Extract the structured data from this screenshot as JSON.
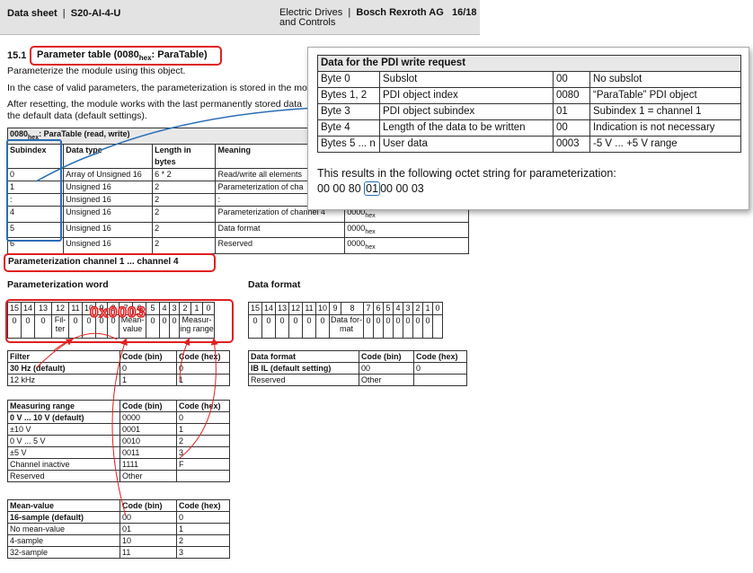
{
  "header": {
    "doc_label": "Data sheet",
    "product": "S20-AI-4-U",
    "category_line1": "Electric Drives",
    "category_line2": "and Controls",
    "company": "Bosch Rexroth AG",
    "page": "16/18"
  },
  "section": {
    "number": "15.1",
    "title_prefix": "Parameter table (0080",
    "title_sub": "hex",
    "title_suffix": ": ParaTable)",
    "para1": "Parameterize the module using this object.",
    "para2": "In the case of valid parameters, the parameterization is stored in the mo",
    "para3a": "After resetting, the module works with the last permanently stored data",
    "para3b": "the default data (default settings)."
  },
  "para_table": {
    "caption_prefix": "0080",
    "caption_sub": "hex",
    "caption_suffix": ": ParaTable (read, write)",
    "headers": [
      "Subindex",
      "Data type",
      "Length in bytes",
      "Meaning"
    ],
    "rows": [
      [
        "0",
        "Array of Unsigned 16",
        "6 * 2",
        "Read/write all elements",
        ""
      ],
      [
        "1",
        "Unsigned 16",
        "2",
        "Parameterization of cha",
        ""
      ],
      [
        ":",
        "Unsigned 16",
        "2",
        ":",
        ""
      ],
      [
        "4",
        "Unsigned 16",
        "2",
        "Parameterization of channel 4",
        "0000"
      ],
      [
        "5",
        "Unsigned 16",
        "2",
        "Data format",
        "0000"
      ],
      [
        "6",
        "Unsigned 16",
        "2",
        "Reserved",
        "0000"
      ]
    ],
    "hex_sub": "hex"
  },
  "popup": {
    "title": "Data for the PDI write request",
    "rows": [
      [
        "Byte 0",
        "Subslot",
        "00",
        "No subslot"
      ],
      [
        "Bytes 1, 2",
        "PDI object index",
        "0080",
        "“ParaTable” PDI object"
      ],
      [
        "Byte 3",
        "PDI object subindex",
        "01",
        "Subindex 1 = channel 1"
      ],
      [
        "Byte 4",
        "Length of the data to be written",
        "00",
        "Indication is not necessary"
      ],
      [
        "Bytes 5 ... n",
        "User data",
        "0003",
        "-5 V ... +5 V range"
      ]
    ],
    "result_text": "This results in the following octet string for parameterization:",
    "octets_before": "00 00 80",
    "octets_highlight": "01",
    "octets_after": "00 00 03"
  },
  "channel_heading": "Parameterization channel 1 ... channel 4",
  "param_word": {
    "title": "Parameterization word",
    "bits": [
      "15",
      "14",
      "13",
      "12",
      "11",
      "10",
      "9",
      "8",
      "7",
      "6",
      "5",
      "4",
      "3",
      "2",
      "1",
      "0"
    ],
    "values": [
      "0",
      "0",
      "0",
      "Fil-\nter",
      "0",
      "0",
      "0",
      "0",
      "Mean-\nvalue",
      "0",
      "0",
      "0",
      "0",
      "0",
      "Measur-\ning range",
      ""
    ],
    "overlay": "0x0003"
  },
  "data_format": {
    "title": "Data format",
    "values": [
      "0",
      "0",
      "0",
      "0",
      "0",
      "0",
      "Data for-\nmat",
      "0",
      "0",
      "0",
      "0",
      "0",
      "0",
      "0"
    ]
  },
  "filter_table": {
    "headers": [
      "Filter",
      "Code (bin)",
      "Code (hex)"
    ],
    "rows": [
      [
        "30 Hz (default)",
        "0",
        "0"
      ],
      [
        "12 kHz",
        "1",
        "1"
      ]
    ]
  },
  "range_table": {
    "headers": [
      "Measuring range",
      "Code (bin)",
      "Code (hex)"
    ],
    "rows": [
      [
        "0 V ... 10 V (default)",
        "0000",
        "0"
      ],
      [
        "±10 V",
        "0001",
        "1"
      ],
      [
        "0 V ... 5 V",
        "0010",
        "2"
      ],
      [
        "±5 V",
        "0011",
        "3"
      ],
      [
        "Channel inactive",
        "1111",
        "F"
      ],
      [
        "Reserved",
        "Other",
        ""
      ]
    ]
  },
  "mean_table": {
    "headers": [
      "Mean-value",
      "Code (bin)",
      "Code (hex)"
    ],
    "rows": [
      [
        "16-sample (default)",
        "00",
        "0"
      ],
      [
        "No mean-value",
        "01",
        "1"
      ],
      [
        "4-sample",
        "10",
        "2"
      ],
      [
        "32-sample",
        "11",
        "3"
      ]
    ]
  },
  "format_table": {
    "headers": [
      "Data format",
      "Code (bin)",
      "Code (hex)"
    ],
    "rows": [
      [
        "IB IL (default setting)",
        "00",
        "0"
      ],
      [
        "Reserved",
        "Other",
        ""
      ]
    ]
  },
  "colors": {
    "red": "#e02020",
    "blue": "#2a6db5",
    "header_gray": "#e3e3e3"
  }
}
